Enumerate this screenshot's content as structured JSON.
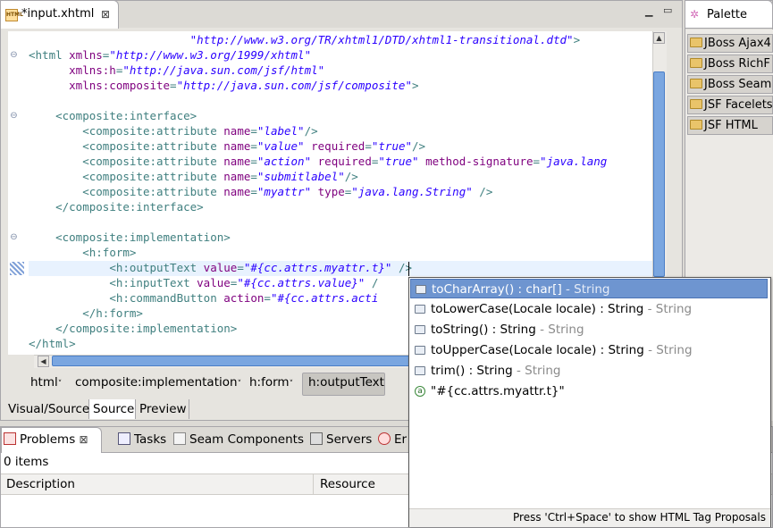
{
  "editor": {
    "tab_title": "*input.xhtml",
    "tab_icon_text": "HTML",
    "code_lines": [
      {
        "indent": "                        ",
        "parts": [
          [
            "av",
            "\"http://www.w3.org/TR/xhtml1/DTD/xhtml1-transitional.dtd\""
          ],
          [
            "tg",
            ">"
          ]
        ]
      },
      {
        "indent": "",
        "parts": [
          [
            "tg",
            "<html "
          ],
          [
            "an",
            "xmlns"
          ],
          [
            "tg",
            "="
          ],
          [
            "av",
            "\"http://www.w3.org/1999/xhtml\""
          ]
        ]
      },
      {
        "indent": "      ",
        "parts": [
          [
            "an",
            "xmlns:h"
          ],
          [
            "tg",
            "="
          ],
          [
            "av",
            "\"http://java.sun.com/jsf/html\""
          ]
        ]
      },
      {
        "indent": "      ",
        "parts": [
          [
            "an",
            "xmlns:composite"
          ],
          [
            "tg",
            "="
          ],
          [
            "av",
            "\"http://java.sun.com/jsf/composite\""
          ],
          [
            "tg",
            ">"
          ]
        ]
      },
      {
        "indent": "",
        "parts": []
      },
      {
        "indent": "    ",
        "parts": [
          [
            "tg",
            "<composite:interface>"
          ]
        ]
      },
      {
        "indent": "        ",
        "parts": [
          [
            "tg",
            "<composite:attribute "
          ],
          [
            "an",
            "name"
          ],
          [
            "tg",
            "="
          ],
          [
            "av",
            "\"label\""
          ],
          [
            "tg",
            "/>"
          ]
        ]
      },
      {
        "indent": "        ",
        "parts": [
          [
            "tg",
            "<composite:attribute "
          ],
          [
            "an",
            "name"
          ],
          [
            "tg",
            "="
          ],
          [
            "av",
            "\"value\""
          ],
          [
            "tg",
            " "
          ],
          [
            "an",
            "required"
          ],
          [
            "tg",
            "="
          ],
          [
            "av",
            "\"true\""
          ],
          [
            "tg",
            "/>"
          ]
        ]
      },
      {
        "indent": "        ",
        "parts": [
          [
            "tg",
            "<composite:attribute "
          ],
          [
            "an",
            "name"
          ],
          [
            "tg",
            "="
          ],
          [
            "av",
            "\"action\""
          ],
          [
            "tg",
            " "
          ],
          [
            "an",
            "required"
          ],
          [
            "tg",
            "="
          ],
          [
            "av",
            "\"true\""
          ],
          [
            "tg",
            " "
          ],
          [
            "an",
            "method-signature"
          ],
          [
            "tg",
            "="
          ],
          [
            "av",
            "\"java.lang"
          ]
        ]
      },
      {
        "indent": "        ",
        "parts": [
          [
            "tg",
            "<composite:attribute "
          ],
          [
            "an",
            "name"
          ],
          [
            "tg",
            "="
          ],
          [
            "av",
            "\"submitlabel\""
          ],
          [
            "tg",
            "/>"
          ]
        ]
      },
      {
        "indent": "        ",
        "parts": [
          [
            "tg",
            "<composite:attribute "
          ],
          [
            "an",
            "name"
          ],
          [
            "tg",
            "="
          ],
          [
            "av",
            "\"myattr\""
          ],
          [
            "tg",
            " "
          ],
          [
            "an",
            "type"
          ],
          [
            "tg",
            "="
          ],
          [
            "av",
            "\"java.lang.String\""
          ],
          [
            "tg",
            " />"
          ]
        ]
      },
      {
        "indent": "    ",
        "parts": [
          [
            "tg",
            "</composite:interface>"
          ]
        ]
      },
      {
        "indent": "",
        "parts": []
      },
      {
        "indent": "    ",
        "parts": [
          [
            "tg",
            "<composite:implementation>"
          ]
        ]
      },
      {
        "indent": "        ",
        "parts": [
          [
            "tg",
            "<h:form>"
          ]
        ]
      },
      {
        "indent": "            ",
        "parts": [
          [
            "tg",
            "<h:outputText "
          ],
          [
            "an",
            "value"
          ],
          [
            "tg",
            "="
          ],
          [
            "av",
            "\"#{cc.attrs.myattr.t}\""
          ],
          [
            "tg",
            " />"
          ]
        ]
      },
      {
        "indent": "            ",
        "parts": [
          [
            "tg",
            "<h:inputText "
          ],
          [
            "an",
            "value"
          ],
          [
            "tg",
            "="
          ],
          [
            "av",
            "\"#{cc.attrs.value}\""
          ],
          [
            "tg",
            " /"
          ]
        ]
      },
      {
        "indent": "            ",
        "parts": [
          [
            "tg",
            "<h:commandButton "
          ],
          [
            "an",
            "action"
          ],
          [
            "tg",
            "="
          ],
          [
            "av",
            "\"#{cc.attrs.acti"
          ]
        ]
      },
      {
        "indent": "        ",
        "parts": [
          [
            "tg",
            "</h:form>"
          ]
        ]
      },
      {
        "indent": "    ",
        "parts": [
          [
            "tg",
            "</composite:implementation>"
          ]
        ]
      },
      {
        "indent": "",
        "parts": [
          [
            "tg",
            "</html>"
          ]
        ]
      }
    ],
    "breadcrumbs": [
      "html",
      "composite:implementation",
      "h:form",
      "h:outputText"
    ],
    "modes": [
      "Visual/Source",
      "Source",
      "Preview"
    ]
  },
  "palette": {
    "title": "Palette",
    "items": [
      "JBoss Ajax4",
      "JBoss RichF",
      "JBoss Seam",
      "JSF Facelets",
      "JSF HTML"
    ]
  },
  "bottom": {
    "tabs": [
      "Problems",
      "Tasks",
      "Seam Components",
      "Servers",
      "Er"
    ],
    "count": "0 items",
    "columns": [
      "Description",
      "Resource"
    ]
  },
  "assist": {
    "proposals": [
      {
        "main": "toCharArray() : char[]",
        "suffix": " - String",
        "icon": "method"
      },
      {
        "main": "toLowerCase(Locale locale) : String",
        "suffix": " - String",
        "icon": "method"
      },
      {
        "main": "toString() : String",
        "suffix": " - String",
        "icon": "method"
      },
      {
        "main": "toUpperCase(Locale locale) : String",
        "suffix": " - String",
        "icon": "method"
      },
      {
        "main": "trim() : String",
        "suffix": " - String",
        "icon": "method"
      },
      {
        "main": "\"#{cc.attrs.myattr.t}\"",
        "suffix": "",
        "icon": "attribute"
      }
    ],
    "hint": "Press 'Ctrl+Space' to show HTML Tag Proposals"
  },
  "colors": {
    "tag": "#3f7f7f",
    "attr_name": "#7f007f",
    "attr_value": "#2a00ff",
    "selection": "#6e95d0"
  }
}
